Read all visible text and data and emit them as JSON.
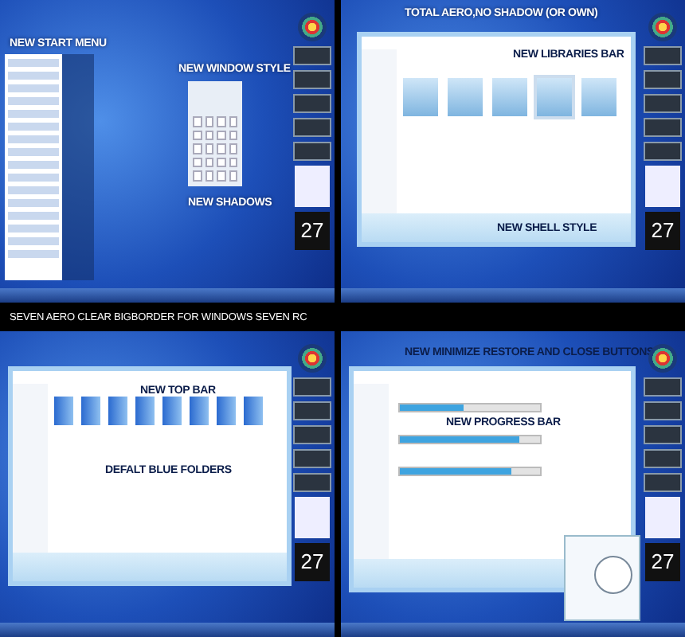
{
  "heading": "SEVEN AERO CLEAR BIGBORDER FOR WINDOWS SEVEN RC",
  "panels": [
    {
      "kind": "start_menu",
      "captions": [
        "NEW START MENU",
        "NEW WINDOW STYLE",
        "NEW SHADOWS"
      ],
      "calendar_day": "27"
    },
    {
      "kind": "libraries",
      "captions": [
        "TOTAL AERO,NO SHADOW (OR OWN)",
        "NEW LIBRARIES BAR",
        "NEW SHELL STYLE"
      ],
      "calendar_day": "27"
    },
    {
      "kind": "folders",
      "captions": [
        "NEW TOP BAR",
        "DEFALT BLUE FOLDERS"
      ],
      "calendar_day": "27"
    },
    {
      "kind": "computer",
      "captions": [
        "NEW MINIMIZE RESTORE AND CLOSE BUTTONS",
        "NEW PROGRESS BAR"
      ],
      "calendar_day": "27",
      "drives": [
        {
          "level": 0.45
        },
        {
          "level": 0.85
        },
        {
          "level": 0.8
        }
      ]
    }
  ]
}
